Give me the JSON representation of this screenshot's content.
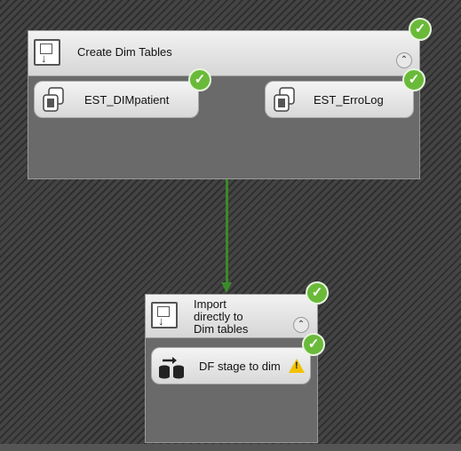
{
  "containers": [
    {
      "id": "create-dim-tables",
      "title": "Create Dim Tables",
      "collapse_glyph": "⌃",
      "status": "success",
      "tasks": [
        {
          "label": "EST_DIMpatient",
          "status": "success",
          "icon": "sql-task-icon"
        },
        {
          "label": "EST_ErroLog",
          "status": "success",
          "icon": "sql-task-icon"
        }
      ]
    },
    {
      "id": "import-directly",
      "title_lines": [
        "Import",
        "directly to",
        "Dim tables"
      ],
      "collapse_glyph": "⌃",
      "status": "success",
      "tasks": [
        {
          "label": "DF stage to dim",
          "status": "success",
          "warning": true,
          "icon": "data-flow-icon"
        }
      ]
    }
  ],
  "connector": {
    "status": "success",
    "color": "#3a8a2a"
  },
  "colors": {
    "success": "#6aba3a",
    "warning": "#f2c200",
    "container_body": "#6a6a6a"
  }
}
